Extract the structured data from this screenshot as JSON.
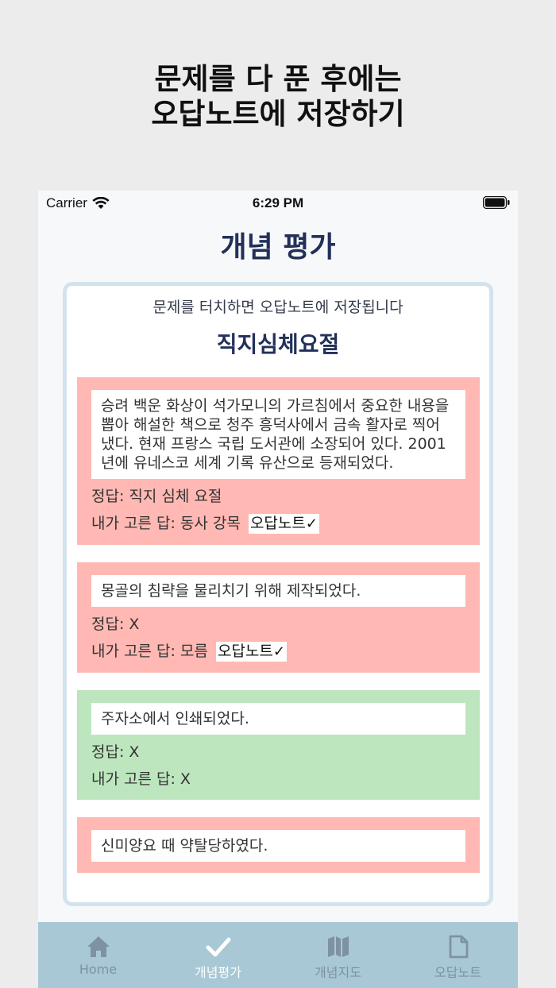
{
  "headline": {
    "line1": "문제를 다 푼 후에는",
    "line2": "오답노트에 저장하기"
  },
  "status_bar": {
    "carrier": "Carrier",
    "time": "6:29 PM"
  },
  "screen_title": "개념 평가",
  "card": {
    "hint": "문제를 터치하면 오답노트에 저장됩니다",
    "topic": "직지심체요절"
  },
  "questions": [
    {
      "question": "승려 백운 화상이 석가모니의 가르침에서 중요한 내용을 뽑아 해설한 책으로 청주 흥덕사에서 금속 활자로 찍어 냈다. 현재 프랑스 국립 도서관에 소장되어 있다. 2001년에 유네스코 세계 기록 유산으로 등재되었다.",
      "correct": "정답: 직지 심체 요절",
      "mine": "내가 고른 답: 동사 강목",
      "note_label": "오답노트",
      "check": "✓",
      "status": "wrong"
    },
    {
      "question": "몽골의 침략을 물리치기 위해 제작되었다.",
      "correct": "정답: X",
      "mine": "내가 고른 답: 모름",
      "note_label": "오답노트",
      "check": "✓",
      "status": "wrong"
    },
    {
      "question": "주자소에서 인쇄되었다.",
      "correct": "정답: X",
      "mine": "내가 고른 답: X",
      "status": "right"
    },
    {
      "question": "신미양요 때 약탈당하였다.",
      "status": "wrong"
    }
  ],
  "tabbar": {
    "home": "Home",
    "evaluation": "개념평가",
    "map": "개념지도",
    "note": "오답노트"
  },
  "colors": {
    "wrong_bg": "#ffb8b3",
    "right_bg": "#bde6bf",
    "title": "#22305a",
    "tabbar_bg": "#a8c8d6"
  }
}
